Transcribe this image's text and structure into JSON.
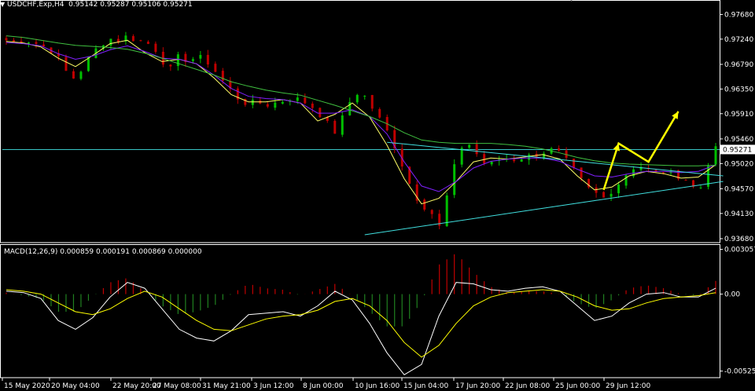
{
  "window": {
    "symbol_header": "USDCHF,Exp,H4",
    "ohlc_header": "0.95142 0.95287 0.95106 0.95271",
    "indicator_header": "MACD(12,26,9) 0.000859 0.000191 0.000869 0.000000"
  },
  "colors": {
    "background": "#000000",
    "bull": "#00c000",
    "bear": "#c00000",
    "frame": "#ffffff",
    "ma_fast": "#ffff66",
    "ma_mid": "#8020ff",
    "ma_slow": "#40c040",
    "trendline": "#40e0e0",
    "arrow": "#ffff00",
    "macd_main": "#ffffff",
    "macd_signal": "#ffff00",
    "hist_pos": "#c00000",
    "hist_neg": "#208020",
    "price_marker_bg": "#ffffff",
    "price_marker_fg": "#000000"
  },
  "chart_data": [
    {
      "type": "candlestick",
      "symbol": "USDCHF",
      "timeframe": "H4",
      "ylim": [
        0.9361,
        0.9777
      ],
      "y_ticks": [
        "0.97680",
        "0.97240",
        "0.96790",
        "0.96350",
        "0.95910",
        "0.95460",
        "0.95020",
        "0.94570",
        "0.94130",
        "0.93680"
      ],
      "current_price": "0.95271",
      "x_ticks": [
        "15 May 2020",
        "20 May 04:00",
        "22 May 20:00",
        "27 May 08:00",
        "31 May 21:00",
        "3 Jun 12:00",
        "8 Jun 00:00",
        "10 Jun 16:00",
        "15 Jun 04:00",
        "17 Jun 20:00",
        "22 Jun 08:00",
        "25 Jun 00:00",
        "29 Jun 12:00"
      ],
      "close_path": [
        0.9722,
        0.9718,
        0.9724,
        0.9719,
        0.9713,
        0.9706,
        0.969,
        0.9664,
        0.9652,
        0.9678,
        0.97,
        0.9716,
        0.9725,
        0.9721,
        0.973,
        0.9722,
        0.9718,
        0.9712,
        0.9686,
        0.967,
        0.9695,
        0.9685,
        0.9692,
        0.9688,
        0.967,
        0.965,
        0.9632,
        0.9615,
        0.9608,
        0.9612,
        0.9606,
        0.961,
        0.9614,
        0.962,
        0.9615,
        0.9608,
        0.9595,
        0.9575,
        0.9558,
        0.9588,
        0.9622,
        0.9632,
        0.9608,
        0.9585,
        0.956,
        0.953,
        0.949,
        0.9452,
        0.9428,
        0.942,
        0.9385,
        0.9448,
        0.9508,
        0.9545,
        0.9528,
        0.9504,
        0.95,
        0.951,
        0.9512,
        0.9508,
        0.9516,
        0.9514,
        0.9522,
        0.9526,
        0.952,
        0.9502,
        0.9482,
        0.946,
        0.945,
        0.944,
        0.9455,
        0.947,
        0.949,
        0.95,
        0.9492,
        0.9484,
        0.9488,
        0.9482,
        0.948,
        0.947,
        0.9445,
        0.95,
        0.9527
      ],
      "moving_averages": [
        {
          "values": [
            0.972,
            0.9717,
            0.971,
            0.969,
            0.9675,
            0.9695,
            0.9716,
            0.9722,
            0.97,
            0.9684,
            0.9688,
            0.968,
            0.9655,
            0.9625,
            0.9612,
            0.9612,
            0.9616,
            0.961,
            0.9578,
            0.959,
            0.961,
            0.9585,
            0.9535,
            0.9475,
            0.943,
            0.944,
            0.947,
            0.9505,
            0.9512,
            0.951,
            0.9514,
            0.9518,
            0.951,
            0.948,
            0.9455,
            0.946,
            0.948,
            0.9488,
            0.9484,
            0.9476,
            0.9478,
            0.95
          ]
        },
        {
          "values": [
            0.9718,
            0.9716,
            0.9712,
            0.9698,
            0.9688,
            0.9694,
            0.9705,
            0.9712,
            0.9702,
            0.969,
            0.9688,
            0.968,
            0.966,
            0.9636,
            0.9622,
            0.9618,
            0.9616,
            0.961,
            0.9592,
            0.9592,
            0.9598,
            0.9586,
            0.9555,
            0.9505,
            0.9462,
            0.9452,
            0.947,
            0.9494,
            0.9506,
            0.951,
            0.9512,
            0.9512,
            0.9506,
            0.9492,
            0.948,
            0.9478,
            0.9484,
            0.9488,
            0.9488,
            0.9486,
            0.9488,
            0.95
          ]
        },
        {
          "values": [
            0.973,
            0.9727,
            0.9722,
            0.9717,
            0.9713,
            0.9711,
            0.9709,
            0.9706,
            0.9699,
            0.969,
            0.968,
            0.967,
            0.966,
            0.9648,
            0.964,
            0.9633,
            0.9628,
            0.9624,
            0.9615,
            0.9606,
            0.9596,
            0.9586,
            0.9573,
            0.9557,
            0.9544,
            0.954,
            0.9538,
            0.9538,
            0.9538,
            0.9536,
            0.9533,
            0.9528,
            0.9521,
            0.9513,
            0.9507,
            0.9503,
            0.9501,
            0.95,
            0.9499,
            0.9498,
            0.9498,
            0.9499
          ]
        }
      ],
      "trendlines": [
        {
          "from": [
            51,
            0.954
          ],
          "to": [
            96,
            0.948
          ]
        },
        {
          "from": [
            48,
            0.9375
          ],
          "to": [
            96,
            0.947
          ]
        }
      ],
      "projection_path": [
        [
          80,
          0.9455
        ],
        [
          82,
          0.9538
        ],
        [
          86,
          0.9505
        ],
        [
          90,
          0.9595
        ]
      ],
      "horizontal_line": 0.95271
    },
    {
      "type": "macd",
      "params": "MACD(12,26,9)",
      "ylim": [
        -0.0057,
        0.0033
      ],
      "y_ticks": [
        "0.003057",
        "0.00",
        "-0.005251"
      ],
      "macd": [
        0.0002,
        0.0001,
        -0.0003,
        -0.0018,
        -0.0024,
        -0.0016,
        -0.0002,
        0.0008,
        0.0004,
        -0.001,
        -0.0024,
        -0.003,
        -0.0032,
        -0.0025,
        -0.0014,
        -0.0013,
        -0.0012,
        -0.0015,
        -0.0008,
        0.0002,
        -0.0004,
        -0.002,
        -0.004,
        -0.0055,
        -0.0048,
        -0.0015,
        0.0008,
        0.0007,
        0.0003,
        0.0002,
        0.0004,
        0.0005,
        0.0002,
        -0.0008,
        -0.0018,
        -0.0015,
        -0.0006,
        0.0,
        0.0001,
        -0.0002,
        -0.0002,
        0.0004
      ],
      "signal": [
        0.0003,
        0.0002,
        0.0,
        -0.0006,
        -0.0012,
        -0.0014,
        -0.001,
        -0.0003,
        0.0002,
        -0.0002,
        -0.001,
        -0.0018,
        -0.0024,
        -0.0025,
        -0.0021,
        -0.0017,
        -0.0015,
        -0.0014,
        -0.0011,
        -0.0005,
        -0.0003,
        -0.0008,
        -0.0018,
        -0.0033,
        -0.0043,
        -0.0035,
        -0.002,
        -0.0008,
        -0.0002,
        0.0001,
        0.0002,
        0.0003,
        0.0002,
        -0.0002,
        -0.0008,
        -0.0011,
        -0.001,
        -0.0006,
        -0.0003,
        -0.0002,
        -0.0001,
        0.0001
      ],
      "histogram": [
        0.0001,
        -0.0001,
        -0.0003,
        -0.0012,
        -0.0012,
        -0.0002,
        0.0008,
        0.0011,
        0.0002,
        -0.0008,
        -0.0014,
        -0.0012,
        -0.0008,
        0.0,
        0.0007,
        0.0004,
        0.0003,
        -0.0001,
        0.0003,
        0.0007,
        -0.0001,
        -0.0012,
        -0.0022,
        -0.0022,
        -0.0005,
        0.002,
        0.0028,
        0.0015,
        0.0005,
        0.0001,
        0.0002,
        0.0002,
        0.0,
        -0.0006,
        -0.001,
        -0.0004,
        0.0004,
        0.0006,
        0.0004,
        0.0,
        -0.0001,
        0.0009
      ]
    }
  ]
}
